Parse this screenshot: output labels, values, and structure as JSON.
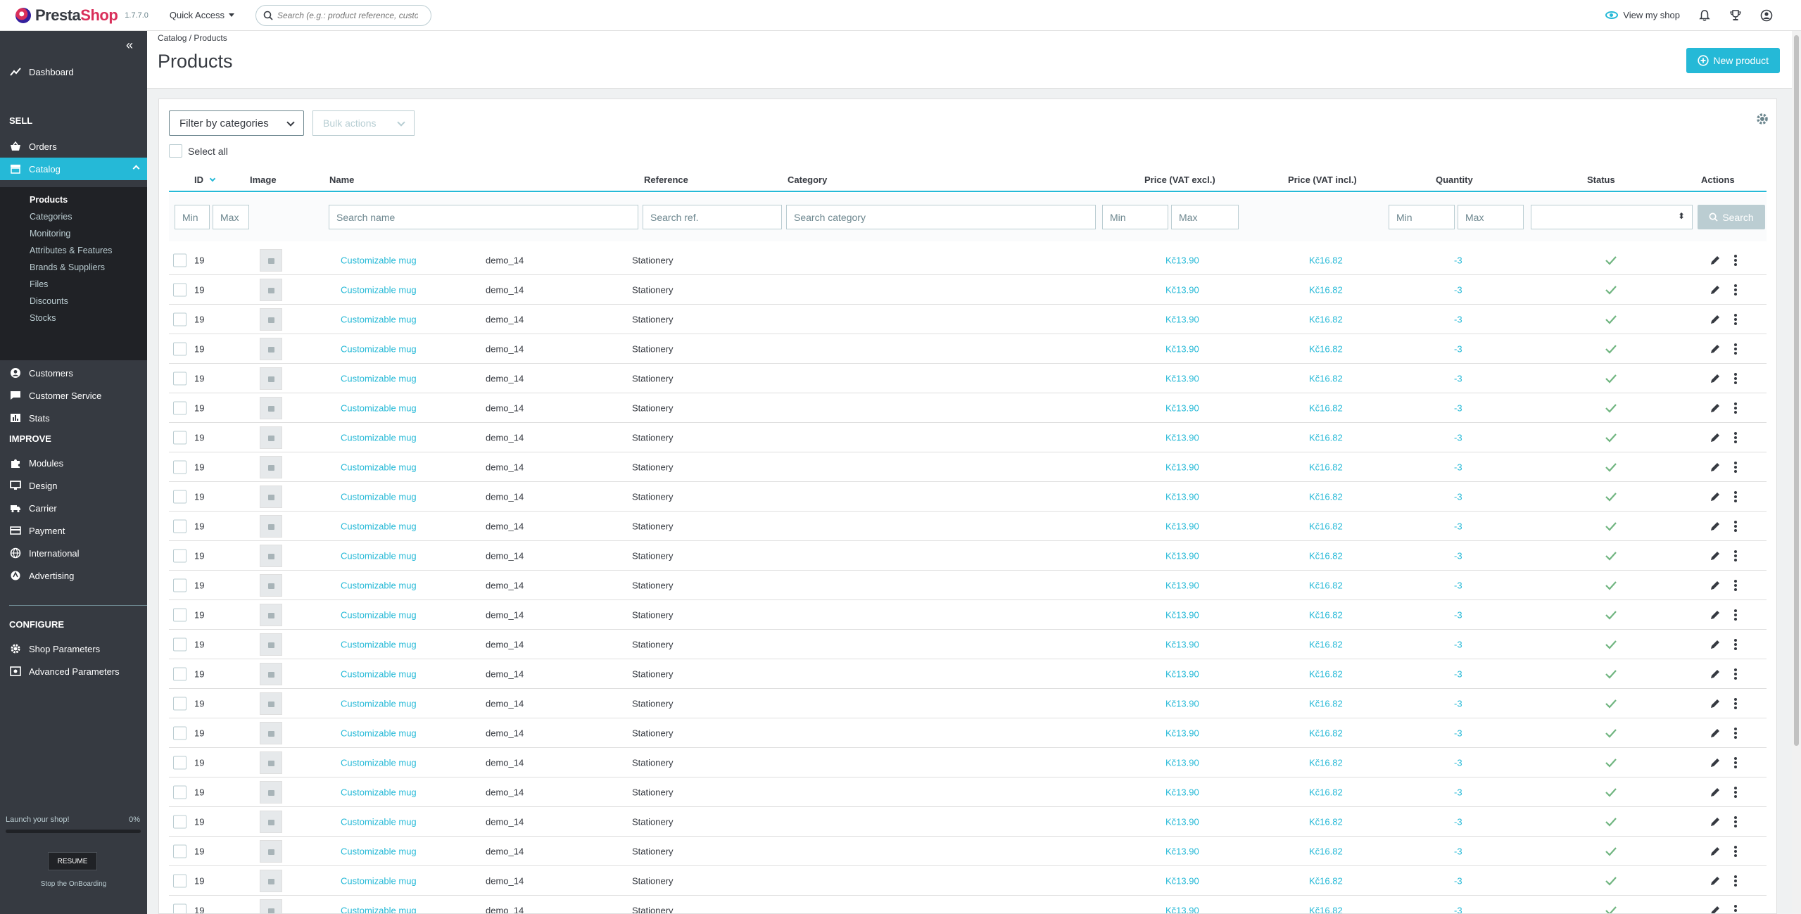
{
  "header": {
    "logo_prefix": "Presta",
    "logo_suffix": "Shop",
    "version": "1.7.7.0",
    "quick_access": "Quick Access",
    "search_placeholder": "Search (e.g.: product reference, custome",
    "view_shop": "View my shop"
  },
  "sidebar": {
    "dashboard": "Dashboard",
    "sections": {
      "sell": "SELL",
      "improve": "IMPROVE",
      "configure": "CONFIGURE"
    },
    "sell_items": [
      "Orders",
      "Catalog",
      "Customers",
      "Customer Service",
      "Stats"
    ],
    "catalog_sub": [
      "Products",
      "Categories",
      "Monitoring",
      "Attributes & Features",
      "Brands & Suppliers",
      "Files",
      "Discounts",
      "Stocks"
    ],
    "improve_items": [
      "Modules",
      "Design",
      "Carrier",
      "Payment",
      "International",
      "Advertising"
    ],
    "configure_items": [
      "Shop Parameters",
      "Advanced Parameters"
    ],
    "onboarding": {
      "label": "Launch your shop!",
      "percent": "0%",
      "progress": 0,
      "resume": "RESUME",
      "stop": "Stop the OnBoarding"
    }
  },
  "page": {
    "breadcrumb": {
      "parent": "Catalog",
      "sep": "/",
      "current": "Products"
    },
    "title": "Products",
    "new_product": "New product"
  },
  "toolbar": {
    "filter_categories": "Filter by categories",
    "bulk_actions": "Bulk actions",
    "select_all": "Select all"
  },
  "table": {
    "columns": {
      "id": "ID",
      "image": "Image",
      "name": "Name",
      "reference": "Reference",
      "category": "Category",
      "price_excl": "Price (VAT excl.)",
      "price_incl": "Price (VAT incl.)",
      "quantity": "Quantity",
      "status": "Status",
      "actions": "Actions"
    },
    "filters": {
      "id_min": "Min",
      "id_max": "Max",
      "name": "Search name",
      "ref": "Search ref.",
      "category": "Search category",
      "price_min": "Min",
      "price_max": "Max",
      "qty_min": "Min",
      "qty_max": "Max",
      "search": "Search"
    },
    "row_template": {
      "id": "19",
      "name": "Customizable mug",
      "reference": "demo_14",
      "category": "Stationery",
      "price_excl": "Kč13.90",
      "price_incl": "Kč16.82",
      "quantity": "-3"
    },
    "row_count": 23
  },
  "colors": {
    "accent": "#25b9d7",
    "sidebar": "#363a41",
    "success": "#70b580"
  }
}
